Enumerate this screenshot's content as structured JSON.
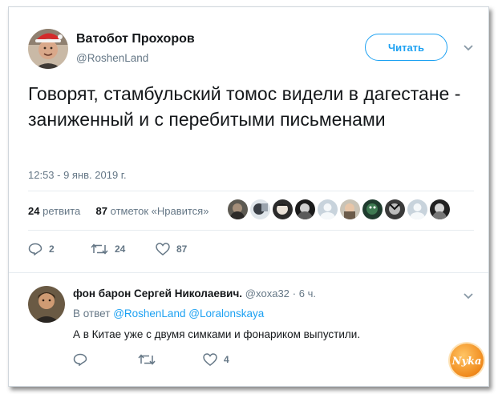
{
  "tweet": {
    "author_name": "Ватобот Прохоров",
    "author_handle": "@RoshenLand",
    "follow_label": "Читать",
    "text": "Говорят, стамбульский томос видели в дагестане - заниженный и с перебитыми письменами",
    "timestamp": "12:53 - 9 янв. 2019 г.",
    "retweet_count": "24",
    "retweet_label": "ретвита",
    "like_count": "87",
    "like_label": "отметок «Нравится»",
    "actions": {
      "reply_count": "2",
      "retweet_count": "24",
      "like_count": "87"
    }
  },
  "reply": {
    "author_name": "фон барон Сергей Николаевич.",
    "author_handle": "@xoxa32",
    "separator": "·",
    "time_ago": "6 ч.",
    "in_reply_prefix": "В ответ",
    "mention_1": "@RoshenLand",
    "mention_2": "@Loralonskaya",
    "text": "А в Китае уже с двумя симками и фонариком выпустили.",
    "actions": {
      "reply_count": "",
      "retweet_count": "",
      "like_count": "4"
    }
  },
  "watermark": {
    "text": "Nyka"
  },
  "colors": {
    "accent": "#1da1f2",
    "muted_text": "#657786",
    "main_text": "#14171a",
    "divider": "#e6ecf0"
  },
  "liker_avatars": [
    "avatar-1",
    "avatar-2",
    "avatar-3",
    "avatar-4",
    "avatar-5",
    "avatar-6",
    "avatar-7",
    "avatar-8",
    "avatar-9",
    "avatar-10",
    "avatar-11"
  ]
}
